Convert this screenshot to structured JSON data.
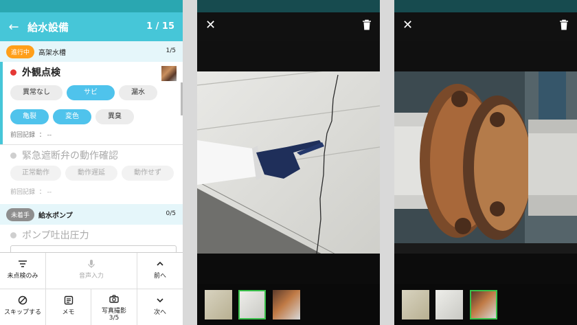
{
  "app": {
    "title": "給水設備",
    "page_count": "1 / 15",
    "sections": [
      {
        "badge": "進行中",
        "name": "高架水槽",
        "count": "1/5",
        "badge_color": "#ff9f1a"
      },
      {
        "badge": "未着手",
        "name": "給水ポンプ",
        "count": "0/5",
        "badge_color": "#8e8e8e"
      }
    ],
    "items": [
      {
        "title": "外観点検",
        "options": [
          "異常なし",
          "サビ",
          "漏水",
          "亀裂",
          "変色",
          "異臭"
        ],
        "selected": [
          "サビ",
          "亀裂",
          "変色"
        ],
        "prev_label": "前回記録",
        "prev_value": "： --"
      },
      {
        "title": "緊急遮断弁の動作確認",
        "options": [
          "正常動作",
          "動作遅延",
          "動作せず"
        ],
        "prev_label": "前回記録",
        "prev_value": "： --"
      },
      {
        "title": "ポンプ吐出圧力"
      }
    ],
    "toolbar": {
      "unchecked_only": "未点検のみ",
      "voice_input": "音声入力",
      "prev": "前へ",
      "skip": "スキップする",
      "memo": "メモ",
      "photo": "写真撮影",
      "photo_count": "3/5",
      "next": "次へ"
    },
    "colors": {
      "accent": "#46c6d8",
      "status_bar": "#2aa7b1",
      "selected_chip": "#4fc3ec",
      "alert_dot": "#e53935",
      "in_progress": "#ff9f1a",
      "not_started": "#8e8e8e",
      "thumb_selected": "#39c24a"
    }
  },
  "viewers": [
    {
      "photo": "cracked-wall-photo",
      "selected_thumb": 1
    },
    {
      "photo": "rusty-pipe-flange-photo",
      "selected_thumb": 2
    }
  ],
  "icons": {
    "back": "arrow-left-icon",
    "filter": "filter-icon",
    "mic": "microphone-icon",
    "chevron_up": "chevron-up-icon",
    "skip": "skip-icon",
    "memo": "memo-icon",
    "camera": "camera-icon",
    "chevron_down": "chevron-down-icon",
    "close": "close-icon",
    "trash": "trash-icon"
  }
}
